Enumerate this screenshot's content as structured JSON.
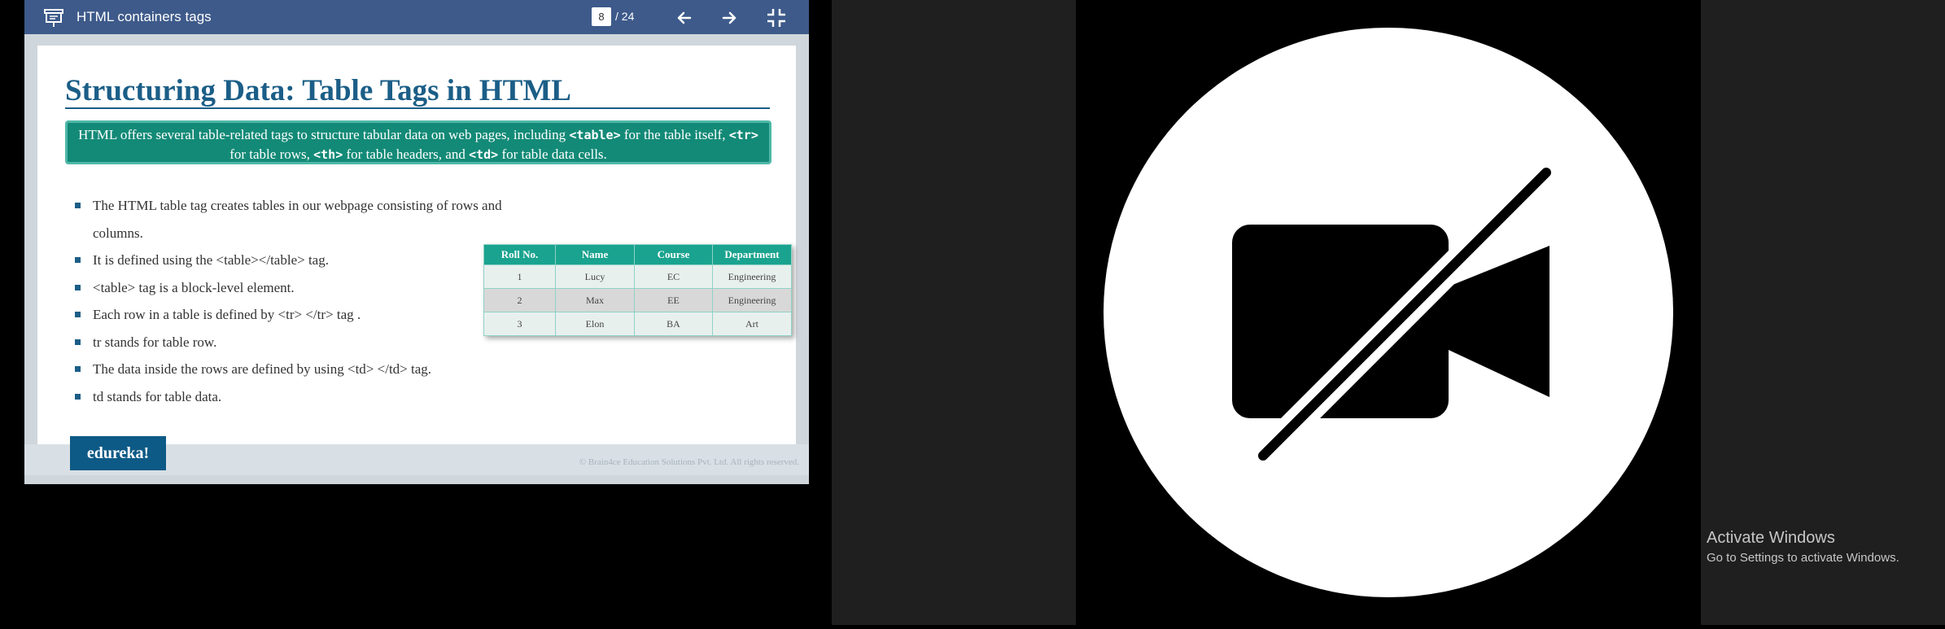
{
  "viewer": {
    "title": "HTML containers tags",
    "current_page": "8",
    "page_total": "/ 24"
  },
  "slide": {
    "title": "Structuring Data: Table Tags in HTML",
    "intro": {
      "p1": "HTML offers several table-related tags to structure tabular data on web pages, including ",
      "c1": "<table>",
      "p2": " for the table itself, ",
      "c2": "<tr>",
      "p3": " for table rows, ",
      "c3": "<th>",
      "p4": " for table headers, and ",
      "c4": "<td>",
      "p5": " for table data cells."
    },
    "bullets": [
      "The HTML table tag creates tables in our webpage consisting of rows and columns.",
      "It is defined using the <table></table> tag.",
      "<table> tag is a block-level element.",
      "Each row in a table is defined by <tr> </tr> tag .",
      "tr stands for table row.",
      "The data inside the rows are defined by using <td> </td> tag.",
      "td stands for table data."
    ],
    "table": {
      "headers": [
        "Roll No.",
        "Name",
        "Course",
        "Department"
      ],
      "rows": [
        [
          "1",
          "Lucy",
          "EC",
          "Engineering"
        ],
        [
          "2",
          "Max",
          "EE",
          "Engineering"
        ],
        [
          "3",
          "Elon",
          "BA",
          "Art"
        ]
      ]
    },
    "brand": "edureka!",
    "copyright": "© Brain4ce Education Solutions Pvt. Ltd. All rights reserved."
  },
  "camera": {
    "icon": "camera-off-icon"
  },
  "watermark": {
    "line1": "Activate Windows",
    "line2": "Go to Settings to activate Windows."
  },
  "colors": {
    "viewer_bar": "#3d5a8a",
    "slide_title": "#1b5e87",
    "intro_bg": "#138a77",
    "table_header": "#1aa38f",
    "brand_bg": "#0e5a86"
  }
}
